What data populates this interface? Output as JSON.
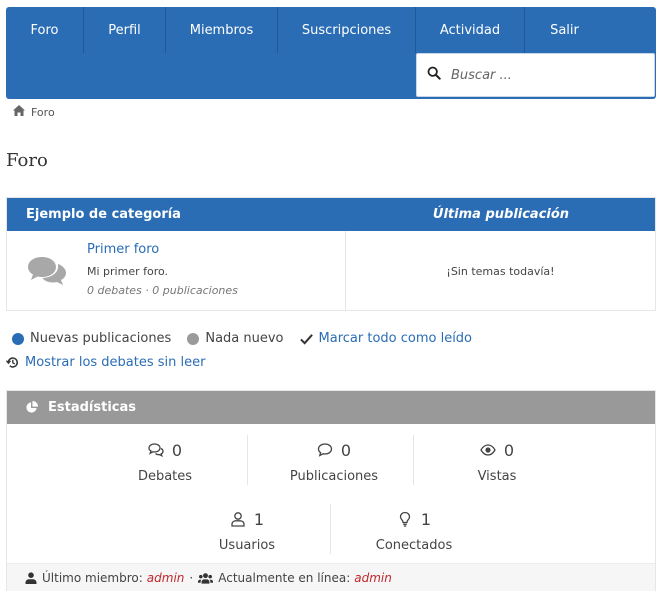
{
  "nav": {
    "tabs": [
      {
        "label": "Foro"
      },
      {
        "label": "Perfil"
      },
      {
        "label": "Miembros"
      },
      {
        "label": "Suscripciones"
      },
      {
        "label": "Actividad"
      },
      {
        "label": "Salir"
      }
    ],
    "search_placeholder": "Buscar ..."
  },
  "breadcrumb": {
    "label": "Foro"
  },
  "page": {
    "title": "Foro"
  },
  "forum": {
    "category_header": "Ejemplo de categoría",
    "last_post_header": "Última publicación",
    "title": "Primer foro",
    "description": "Mi primer foro.",
    "stats": "0 debates · 0 publicaciones",
    "last_post": "¡Sin temas todavía!"
  },
  "legend": {
    "new_posts": "Nuevas publicaciones",
    "nothing_new": "Nada nuevo",
    "mark_all_read": "Marcar todo como leído",
    "show_unread": "Mostrar los debates sin leer"
  },
  "stats": {
    "title": "Estadísticas",
    "items": [
      {
        "value": "0",
        "label": "Debates",
        "icon": "comments-icon"
      },
      {
        "value": "0",
        "label": "Publicaciones",
        "icon": "comment-icon"
      },
      {
        "value": "0",
        "label": "Vistas",
        "icon": "eye-icon"
      },
      {
        "value": "1",
        "label": "Usuarios",
        "icon": "user-icon"
      },
      {
        "value": "1",
        "label": "Conectados",
        "icon": "lightbulb-icon"
      }
    ],
    "latest_member_label": "Último miembro:",
    "latest_member": "admin",
    "separator": "·",
    "online_label": "Actualmente en línea:",
    "online_user": "admin"
  },
  "colors": {
    "primary": "#2a6db5",
    "new_dot": "#2a6db5",
    "old_dot": "#9a9a9a",
    "user_link": "#c0282d"
  }
}
